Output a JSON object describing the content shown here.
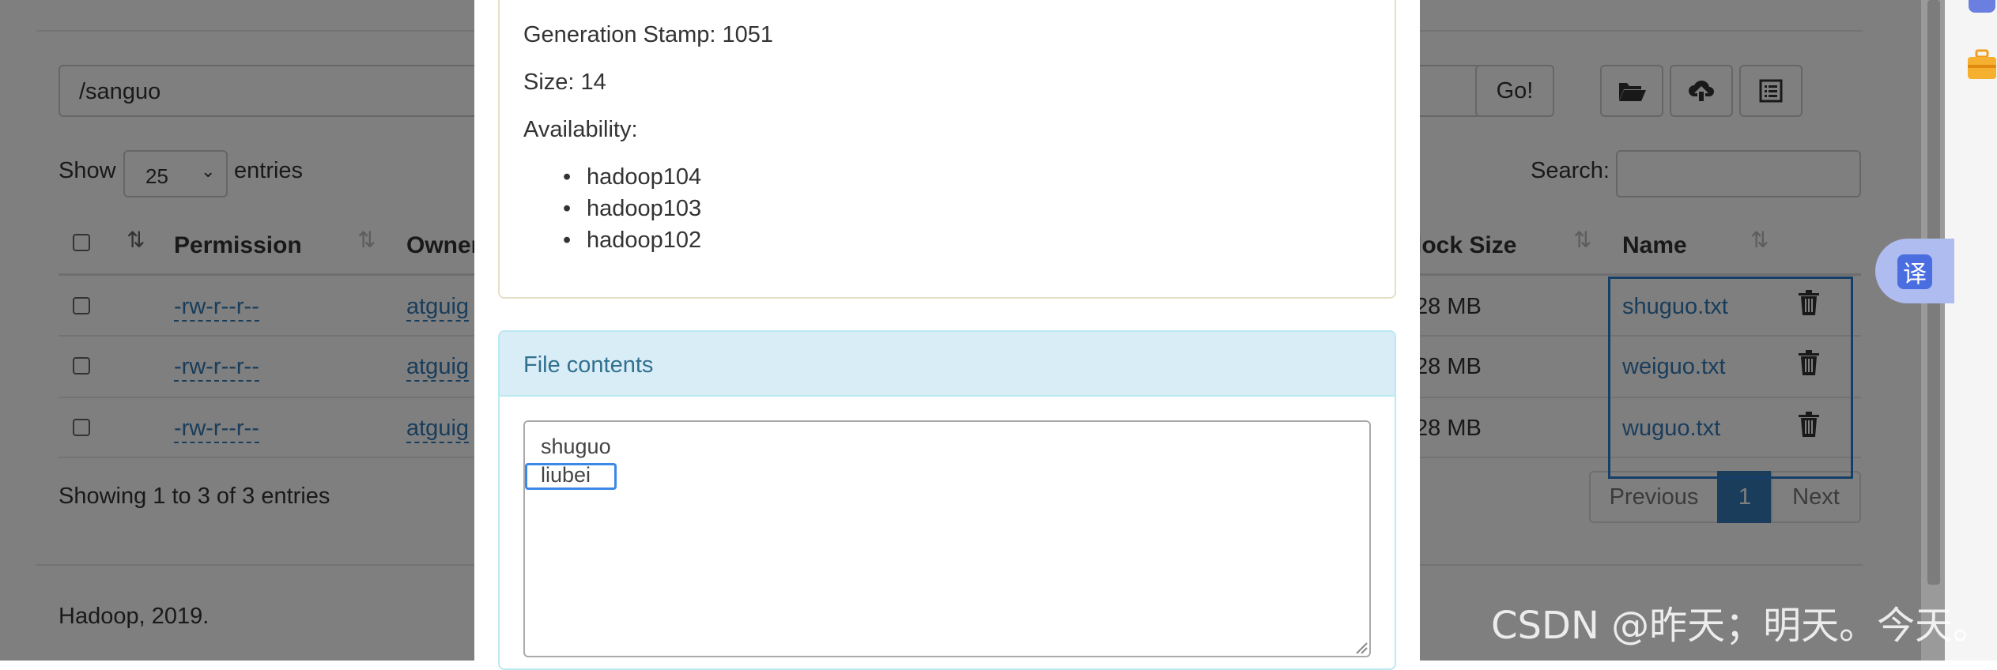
{
  "browse": {
    "path_value": "/sanguo",
    "go_label": "Go!",
    "show_label": "Show",
    "page_size_value": "25",
    "entries_label": "entries",
    "search_label": "Search:",
    "search_value": "",
    "columns": {
      "permission": "Permission",
      "owner": "Owner",
      "block_size": "lock Size",
      "name": "Name"
    },
    "rows": [
      {
        "permission": "-rw-r--r--",
        "owner": "atguig",
        "block_size": "28 MB",
        "name": "shuguo.txt"
      },
      {
        "permission": "-rw-r--r--",
        "owner": "atguig",
        "block_size": "28 MB",
        "name": "weiguo.txt"
      },
      {
        "permission": "-rw-r--r--",
        "owner": "atguig",
        "block_size": "28 MB",
        "name": "wuguo.txt"
      }
    ],
    "info_text": "Showing 1 to 3 of 3 entries",
    "pagination": {
      "previous": "Previous",
      "current": "1",
      "next": "Next"
    },
    "footer": "Hadoop, 2019."
  },
  "modal": {
    "generation_stamp": "Generation Stamp: 1051",
    "size": "Size: 14",
    "availability_label": "Availability:",
    "availability": [
      "hadoop104",
      "hadoop103",
      "hadoop102"
    ],
    "file_contents_title": "File contents",
    "file_lines": [
      "shuguo",
      "liubei"
    ]
  },
  "translate_icon_label": "译",
  "watermark": "CSDN @昨天；明天。今天。",
  "colors": {
    "link": "#337ab7",
    "panel_info_bg": "#d9edf7",
    "pager_active": "#337ab7",
    "overlay": "rgba(0,0,0,0.5)"
  }
}
